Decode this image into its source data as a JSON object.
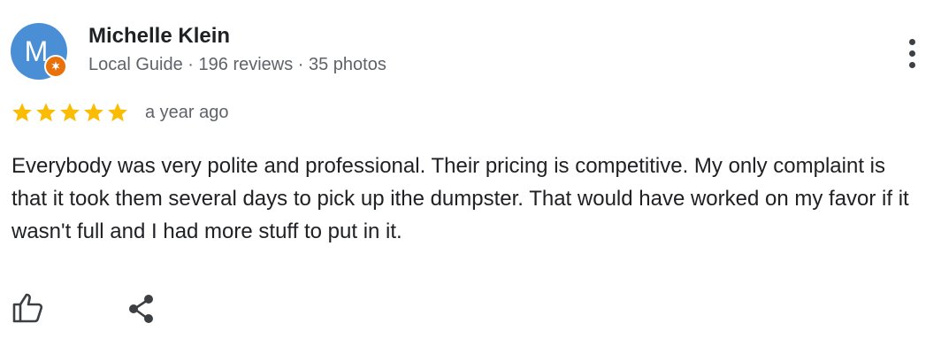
{
  "author": {
    "avatar_letter": "M",
    "name": "Michelle Klein",
    "meta": "Local Guide · 196 reviews · 35 photos"
  },
  "review": {
    "rating": 5,
    "rating_max": 5,
    "date": "a year ago",
    "text": "Everybody was very polite and professional. Their pricing is competitive. My only complaint is that it took them several days to pick up ithe dumpster. That would have worked on my favor if it wasn't full and I had more stuff to put in it."
  },
  "icons": {
    "more": "more-vert-icon",
    "badge": "local-guide-star-icon",
    "star": "star-icon",
    "like": "thumbs-up-icon",
    "share": "share-icon"
  },
  "colors": {
    "avatar": "#4a8fd6",
    "badge": "#e8710a",
    "star": "#fbbc04",
    "text": "#202124",
    "secondary_text": "#5f6368"
  }
}
